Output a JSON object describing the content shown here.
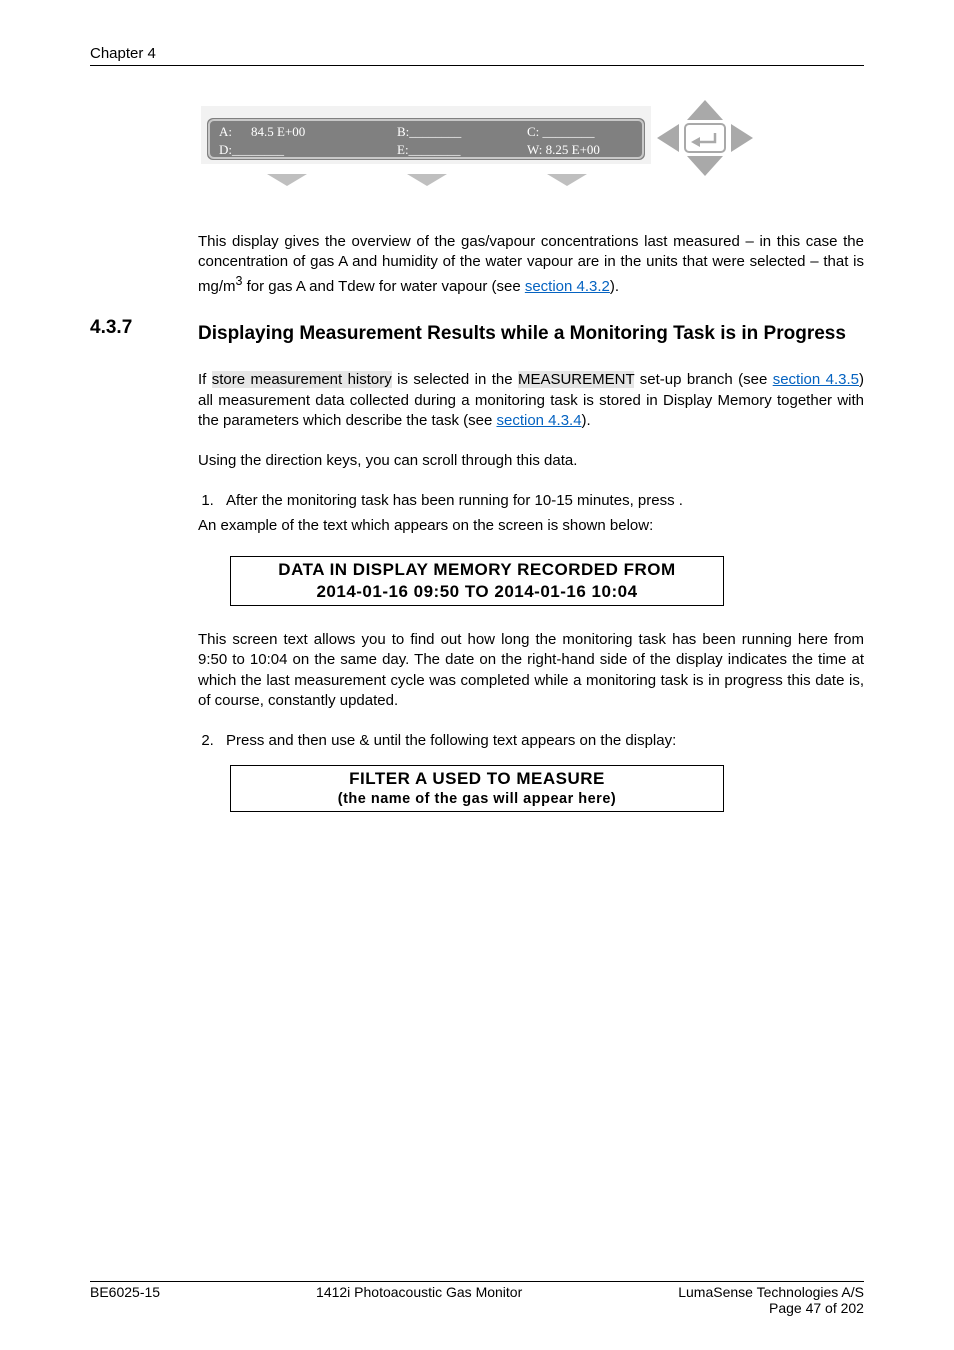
{
  "header": {
    "chapter": "Chapter 4"
  },
  "chart_data": {
    "type": "table",
    "title": "LCD readout of gas/vapour concentrations (example)",
    "rows": [
      {
        "channel": "A",
        "value": "84.5 E+00"
      },
      {
        "channel": "B",
        "value": "________"
      },
      {
        "channel": "C",
        "value": "________"
      },
      {
        "channel": "D",
        "value": "________"
      },
      {
        "channel": "E",
        "value": "________"
      },
      {
        "channel": "W",
        "value": "8.25 E+00"
      }
    ],
    "arrows": [
      "up",
      "left",
      "enter",
      "right",
      "down",
      "down",
      "down",
      "down"
    ]
  },
  "lcd": {
    "a_label": "A:",
    "a_value": "84.5 E+00",
    "b_label": "B:________",
    "c_label": "C: ________",
    "d_label": "D:________",
    "e_label": "E:________",
    "w_label": "W: 8.25 E+00"
  },
  "para1_a": "This display gives the overview of the gas/vapour concentrations last measured – in this case the concentration of gas A and humidity of the water vapour are in the units that were selected – that is mg/m",
  "para1_sup": "3",
  "para1_b": " for gas A and Tdew for water vapour (see ",
  "para1_link": "section 4.3.2",
  "para1_c": ").",
  "section": {
    "num": "4.3.7",
    "title": "Displaying Measurement Results while a Monitoring Task is in Progress"
  },
  "para2_a": "If ",
  "para2_hl1": "store measurement history",
  "para2_b": " is selected in the ",
  "para2_hl2": "MEASUREMENT",
  "para2_c": " set-up branch (see ",
  "para2_link": "section 4.3.5",
  "para2_d": ") all measurement data collected during a monitoring task is stored in Display Memory together with the parameters which describe the task (see ",
  "para2_link2": "section 4.3.4",
  "para2_e": ").",
  "para3": "Using the direction keys, you can scroll through this data.",
  "list1_a": "After the monitoring task has been running for 10-15 minutes, press   .",
  "after_list1": "An example of the text which appears on the screen is shown below:",
  "box1_l1": "DATA IN DISPLAY MEMORY RECORDED FROM",
  "box1_l2": "2014-01-16  09:50  TO  2014-01-16  10:04",
  "para4": "This screen text allows you to find out how long the monitoring task has been running here from 9:50 to 10:04 on the same day. The date on the right-hand side of the display indicates the time at which the last measurement cycle was completed while a monitoring task is in progress this date is, of course, constantly updated.",
  "list2_a": "Press    and then use    &    until the following text appears on the display:",
  "box2_l1": "FILTER A USED TO MEASURE",
  "box2_l2": "(the name of the gas will appear here)",
  "footer": {
    "left": "BE6025-15",
    "center": "1412i Photoacoustic Gas Monitor",
    "right1": "LumaSense Technologies A/S",
    "right2": "Page 47 of 202"
  }
}
